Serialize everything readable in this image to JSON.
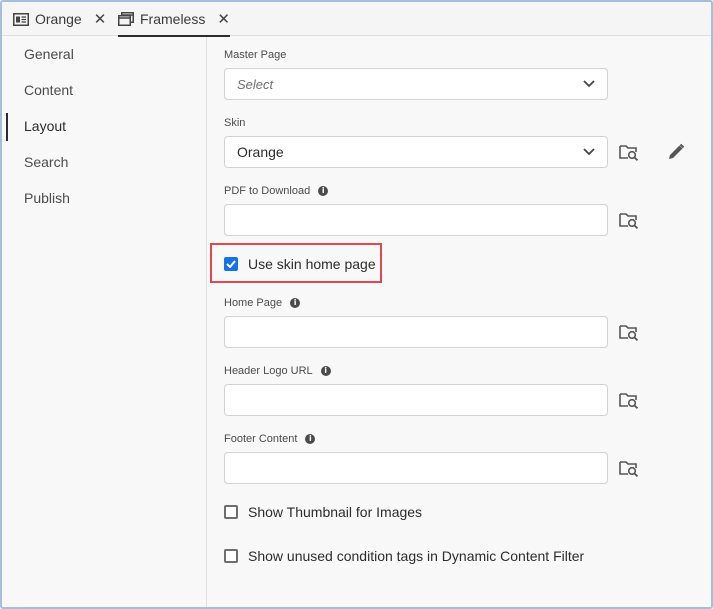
{
  "tabs": [
    {
      "label": "Orange",
      "icon": "panel-icon",
      "close": "✕"
    },
    {
      "label": "Frameless",
      "icon": "window-icon",
      "close": "✕"
    }
  ],
  "sidebar": {
    "items": [
      {
        "label": "General"
      },
      {
        "label": "Content"
      },
      {
        "label": "Layout",
        "active": true
      },
      {
        "label": "Search"
      },
      {
        "label": "Publish"
      }
    ]
  },
  "form": {
    "master_page": {
      "label": "Master Page",
      "placeholder": "Select"
    },
    "skin": {
      "label": "Skin",
      "value": "Orange"
    },
    "pdf": {
      "label": "PDF to Download",
      "value": ""
    },
    "use_skin_home": {
      "label": "Use skin home page",
      "checked": true
    },
    "home_page": {
      "label": "Home Page",
      "value": ""
    },
    "header_logo": {
      "label": "Header Logo URL",
      "value": ""
    },
    "footer": {
      "label": "Footer Content",
      "value": ""
    },
    "show_thumbnail": {
      "label": "Show Thumbnail for Images",
      "checked": false
    },
    "show_unused": {
      "label": "Show unused condition tags in Dynamic Content Filter",
      "checked": false
    }
  },
  "colors": {
    "accent": "#1473e6",
    "highlight": "#e34850",
    "frame_border": "#a6bedb"
  }
}
